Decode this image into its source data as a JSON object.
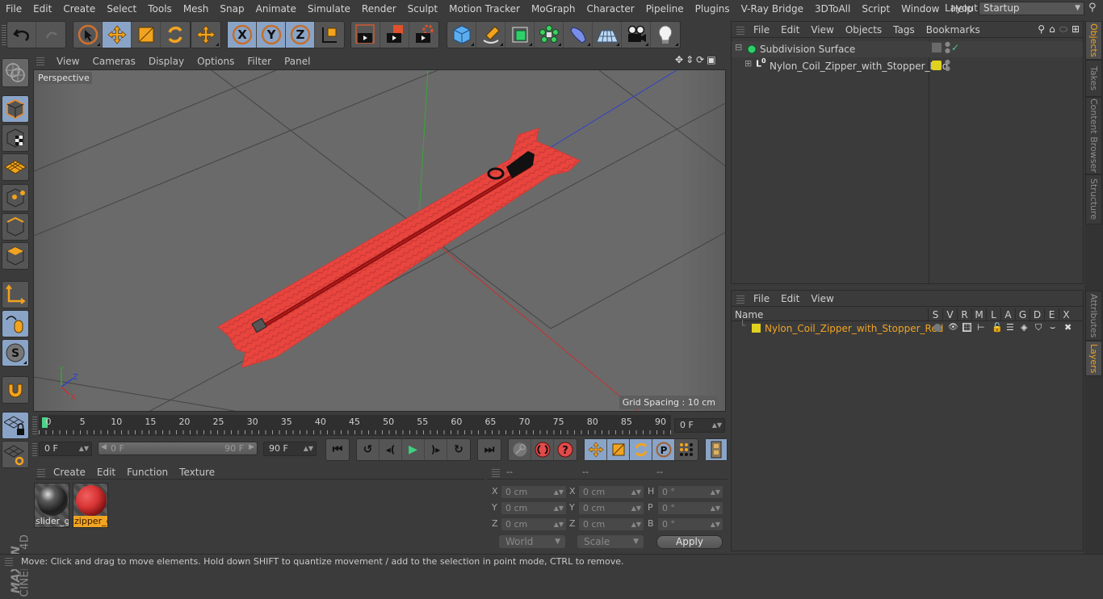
{
  "app": {
    "name": "Cinema 4D",
    "brand_top": "MAXON",
    "brand_bottom": "CINEMA 4D"
  },
  "menubar": {
    "items": [
      "File",
      "Edit",
      "Create",
      "Select",
      "Tools",
      "Mesh",
      "Snap",
      "Animate",
      "Simulate",
      "Render",
      "Sculpt",
      "Motion Tracker",
      "MoGraph",
      "Character",
      "Pipeline",
      "Plugins",
      "V-Ray Bridge",
      "3DToAll",
      "Script",
      "Window",
      "Help"
    ],
    "layout_label": "Layout:",
    "layout_value": "Startup"
  },
  "toolbar": {
    "groups": [
      {
        "id": "history",
        "buttons": [
          "undo-icon",
          "redo-icon"
        ]
      },
      {
        "id": "tools",
        "buttons": [
          "live-select-icon",
          "move-icon",
          "scale-icon",
          "rotate-icon"
        ]
      },
      {
        "id": "recent",
        "buttons": [
          "recent-tool-icon"
        ]
      },
      {
        "id": "axes",
        "buttons": [
          "x-axis-icon",
          "y-axis-icon",
          "z-axis-icon",
          "coordinate-system-icon"
        ]
      },
      {
        "id": "render",
        "buttons": [
          "render-view-icon",
          "render-picture-viewer-icon",
          "render-settings-icon"
        ]
      },
      {
        "id": "create",
        "buttons": [
          "cube-icon",
          "pen-icon",
          "subdivision-icon",
          "cloner-icon",
          "deformer-icon",
          "floor-icon",
          "camera-icon",
          "light-icon"
        ]
      }
    ],
    "axis_labels": [
      "X",
      "Y",
      "Z"
    ]
  },
  "left_tools": [
    "make-editable-icon",
    "model-mode-icon",
    "texture-mode-icon",
    "workplane-icon",
    "points-mode-icon",
    "edges-mode-icon",
    "polygons-mode-icon",
    "axis-mode-icon",
    "tweak-mode-icon",
    "solo-icon",
    "snap-icon",
    "lock-workplane-icon",
    "planar-workplane-icon"
  ],
  "viewport": {
    "menu": [
      "View",
      "Cameras",
      "Display",
      "Options",
      "Filter",
      "Panel"
    ],
    "camera_label": "Perspective",
    "grid_spacing": "Grid Spacing : 10 cm",
    "axis_gizmo": {
      "x": "X",
      "y": "Y",
      "z": "Z"
    },
    "scene_object": "Nylon_Coil_Zipper_with_Stopper_Red",
    "colors": {
      "zipper": "#e8453f",
      "slider": "#111111",
      "background": "#6a6a6a"
    }
  },
  "timeline": {
    "ticks": [
      "0",
      "5",
      "10",
      "15",
      "20",
      "25",
      "30",
      "35",
      "40",
      "45",
      "50",
      "55",
      "60",
      "65",
      "70",
      "75",
      "80",
      "85",
      "90"
    ],
    "current_frame": "0 F",
    "start_field": "0 F",
    "range_start": "0 F",
    "range_end": "90 F",
    "end_field": "90 F",
    "accent": "#4ed28a"
  },
  "transport": {
    "playback": [
      "go-to-start-icon",
      "previous-key-icon",
      "previous-frame-icon",
      "play-icon",
      "next-frame-icon",
      "next-key-icon",
      "go-to-end-icon"
    ],
    "keys": [
      "keyframe-selection-icon",
      "autokey-icon",
      "record-help-icon"
    ],
    "key_tracks": [
      "position-key-icon",
      "scale-key-icon",
      "rotation-key-icon",
      "parameter-key-icon",
      "pla-key-icon"
    ],
    "timeline_icon": "timeline-window-icon"
  },
  "materials": {
    "menu": [
      "Create",
      "Edit",
      "Function",
      "Texture"
    ],
    "items": [
      {
        "name": "slider_g",
        "selected": false,
        "color": "#2a2a2a"
      },
      {
        "name": "zipper_c",
        "selected": true,
        "color": "#d93535"
      }
    ]
  },
  "coordinates": {
    "headers": [
      "--",
      "--",
      "--"
    ],
    "position": {
      "label": [
        "X",
        "Y",
        "Z"
      ],
      "values": [
        "0 cm",
        "0 cm",
        "0 cm"
      ]
    },
    "size": {
      "label": [
        "X",
        "Y",
        "Z"
      ],
      "values": [
        "0 cm",
        "0 cm",
        "0 cm"
      ]
    },
    "rotation": {
      "label": [
        "H",
        "P",
        "B"
      ],
      "values": [
        "0 °",
        "0 °",
        "0 °"
      ]
    },
    "mode_dropdown": "World",
    "size_dropdown": "Scale",
    "apply_label": "Apply"
  },
  "status": {
    "text": "Move: Click and drag to move elements. Hold down SHIFT to quantize movement / add to the selection in point mode, CTRL to remove."
  },
  "objects_panel": {
    "menu": [
      "File",
      "Edit",
      "View",
      "Objects",
      "Tags",
      "Bookmarks"
    ],
    "rows": [
      {
        "name": "Subdivision Surface",
        "type": "subdivision",
        "expanded": true,
        "check": "✓"
      },
      {
        "name": "Nylon_Coil_Zipper_with_Stopper_Red",
        "type": "null",
        "expanded": false,
        "layer_color": "#e0d020"
      }
    ]
  },
  "layers_panel": {
    "menu": [
      "File",
      "Edit",
      "View"
    ],
    "columns": [
      "Name",
      "S",
      "V",
      "R",
      "M",
      "L",
      "A",
      "G",
      "D",
      "E",
      "X"
    ],
    "rows": [
      {
        "name": "Nylon_Coil_Zipper_with_Stopper_Red",
        "color": "#e0d020",
        "text_color": "#f0a422"
      }
    ]
  },
  "right_tabs": {
    "top": [
      {
        "label": "Objects",
        "active": true
      },
      {
        "label": "Takes",
        "active": false
      },
      {
        "label": "Content Browser",
        "active": false
      },
      {
        "label": "Structure",
        "active": false
      }
    ],
    "bottom": [
      {
        "label": "Attributes",
        "active": false
      },
      {
        "label": "Layers",
        "active": true
      }
    ]
  }
}
